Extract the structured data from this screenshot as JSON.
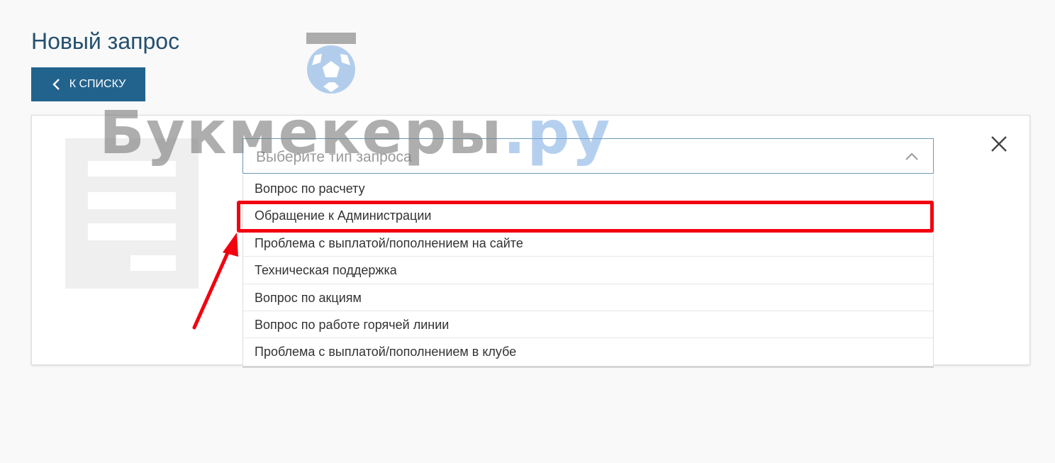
{
  "page": {
    "title": "Новый запрос",
    "back_button_label": "К СПИСКУ"
  },
  "form": {
    "select_placeholder": "Выберите тип запроса",
    "options": [
      "Вопрос по расчету",
      "Обращение к Администрации",
      "Проблема с выплатой/пополнением на сайте",
      "Техническая поддержка",
      "Вопрос по акциям",
      "Вопрос по работе горячей линии",
      "Проблема с выплатой/пополнением в клубе"
    ],
    "highlighted_option": "Обращение к Администрации"
  },
  "watermark": {
    "main": "Букмекеры",
    "suffix": ".ру"
  },
  "icons": {
    "back": "chevron-left-icon",
    "close": "close-icon",
    "dropdown": "chevron-up-icon",
    "document": "document-icon",
    "logo": "soccer-ball-icon"
  },
  "colors": {
    "title": "#24506f",
    "button_bg": "#22638d",
    "select_border": "#6b99b5",
    "highlight": "#f2000f",
    "watermark_accent": "#78aae1"
  }
}
